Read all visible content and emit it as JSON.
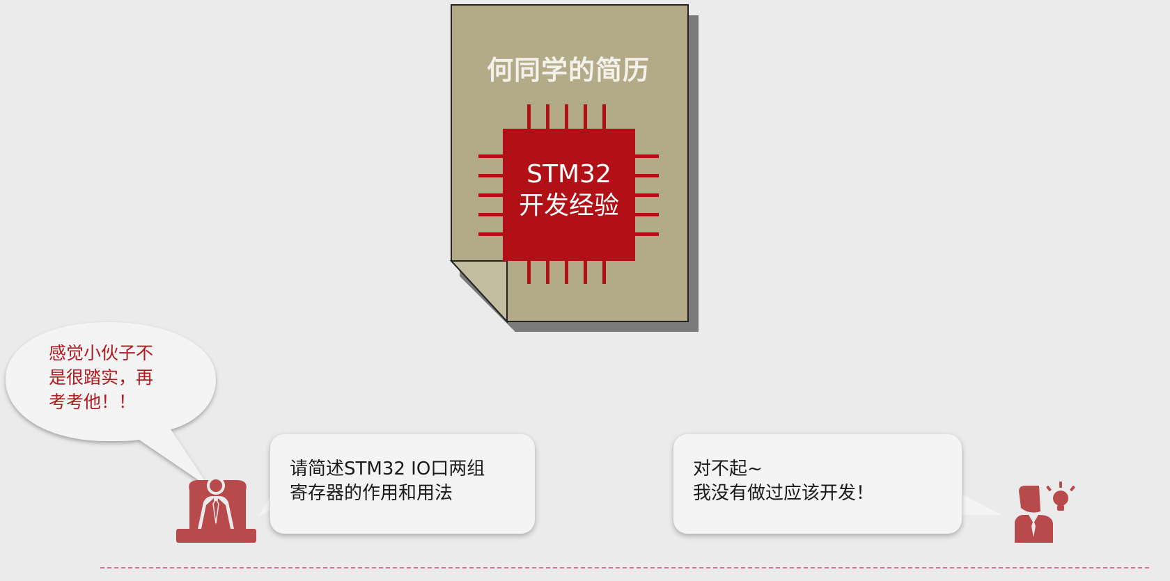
{
  "resume": {
    "title": "何同学的简历",
    "chip_line1": "STM32",
    "chip_line2": "开发经验"
  },
  "interviewer": {
    "thought": "感觉小伙子不\n是很踏实，再\n考考他！！",
    "question": "请简述STM32 IO口两组\n寄存器的作用和用法",
    "icon": "interviewer-at-desk-icon"
  },
  "candidate": {
    "answer": "对不起~\n我没有做过应该开发！",
    "icon": "person-with-lightbulb-icon"
  },
  "colors": {
    "background": "#ebebeb",
    "paper": "#b3aa88",
    "chip_red": "#b11016",
    "icon_red": "#b94a4c",
    "thought_text": "#b11a1f",
    "divider": "#e36f8d"
  }
}
